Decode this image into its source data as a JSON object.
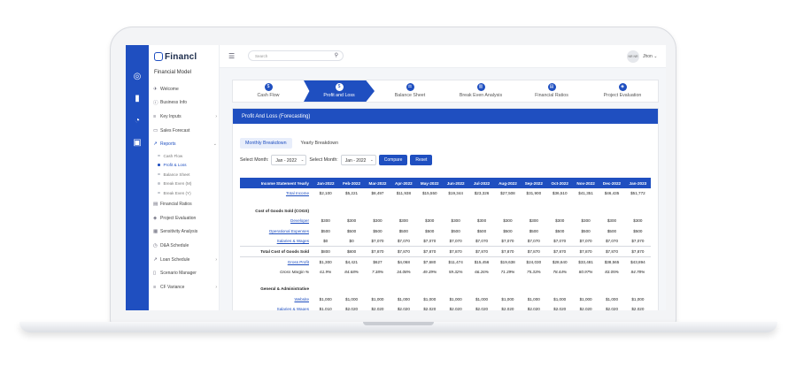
{
  "brand": {
    "name": "Financl",
    "accent": "#1f4fc0"
  },
  "sidebar": {
    "title": "Financial Model",
    "items": [
      {
        "label": "Welcome",
        "icon": "rocket-icon",
        "chevron": false
      },
      {
        "label": "Business Info",
        "icon": "info-icon",
        "chevron": false
      },
      {
        "label": "Key Inputs",
        "icon": "list-icon",
        "chevron": true
      },
      {
        "label": "Sales Forecast",
        "icon": "sales-icon",
        "chevron": false
      },
      {
        "label": "Reports",
        "icon": "trend-icon",
        "chevron": true,
        "active": true
      }
    ],
    "report_subitems": [
      {
        "label": "Cash Flow"
      },
      {
        "label": "Profit & Loss",
        "active": true
      },
      {
        "label": "Balance Sheet"
      },
      {
        "label": "Break Even (M)"
      },
      {
        "label": "Break Even (Y)"
      }
    ],
    "items_after": [
      {
        "label": "Financial Ratios",
        "icon": "ratio-icon",
        "chevron": false
      },
      {
        "label": "Project Evaluation",
        "icon": "evaluation-icon",
        "chevron": false
      },
      {
        "label": "Sensitivity Analysis",
        "icon": "grid-icon",
        "chevron": false
      },
      {
        "label": "D&A Schedule",
        "icon": "clock-icon",
        "chevron": false
      },
      {
        "label": "Loan Schedule",
        "icon": "trend-icon",
        "chevron": true
      },
      {
        "label": "Scenario Manager",
        "icon": "doc-icon",
        "chevron": false
      },
      {
        "label": "CF Variance",
        "icon": "list-icon",
        "chevron": true
      }
    ]
  },
  "header": {
    "search_placeholder": "Search",
    "avatar_initials": "NR NR",
    "user_name": "Jhon"
  },
  "steps": [
    {
      "label": "Cash Flow",
      "icon": "currency-icon"
    },
    {
      "label": "Profit and Loss",
      "icon": "currency-icon",
      "active": true
    },
    {
      "label": "Balance Sheet",
      "icon": "balance-icon"
    },
    {
      "label": "Break Even Analysis",
      "icon": "chart-icon"
    },
    {
      "label": "Financial Ratios",
      "icon": "ratio-icon"
    },
    {
      "label": "Project Evaluation",
      "icon": "evaluation-icon"
    }
  ],
  "panel": {
    "title": "Profit And Loss (Forecasting)",
    "tabs": [
      {
        "label": "Monthly Breakdown",
        "active": true
      },
      {
        "label": "Yearly Breakdown"
      }
    ],
    "filters": {
      "label1": "Select Month:",
      "value1": "Jan - 2022",
      "label2": "Select Month:",
      "value2": "Jan - 2022",
      "compare": "Compare",
      "reset": "Reset"
    }
  },
  "table": {
    "header_label": "Income Statement Yearly",
    "columns": [
      "Jan-2022",
      "Feb-2022",
      "Mar-2022",
      "Apr-2022",
      "May-2022",
      "Jun-2022",
      "Jul-2022",
      "Aug-2022",
      "Sep-2022",
      "Oct-2022",
      "Nov-2022",
      "Dec-2022",
      "Jan-2023"
    ],
    "rows": [
      {
        "label": "Total Income",
        "style": "link",
        "values": [
          "$2,100",
          "$5,221",
          "$8,497",
          "$11,938",
          "$15,550",
          "$19,344",
          "$23,326",
          "$27,508",
          "$31,900",
          "$36,510",
          "$41,351",
          "$46,435",
          "$51,772"
        ]
      },
      {
        "label": "",
        "style": "spacer",
        "values": []
      },
      {
        "label": "Cost of Goods Sold (COGS)",
        "style": "section",
        "values": []
      },
      {
        "label": "Developer",
        "style": "link",
        "values": [
          "$300",
          "$300",
          "$300",
          "$300",
          "$300",
          "$300",
          "$300",
          "$300",
          "$300",
          "$300",
          "$300",
          "$300",
          "$300"
        ]
      },
      {
        "label": "Operational Expenses",
        "style": "link",
        "values": [
          "$500",
          "$500",
          "$500",
          "$500",
          "$500",
          "$500",
          "$500",
          "$500",
          "$500",
          "$500",
          "$500",
          "$500",
          "$500"
        ]
      },
      {
        "label": "Salaries & Wages",
        "style": "link",
        "values": [
          "$0",
          "$0",
          "$7,070",
          "$7,070",
          "$7,070",
          "$7,070",
          "$7,070",
          "$7,070",
          "$7,070",
          "$7,070",
          "$7,070",
          "$7,070",
          "$7,070"
        ]
      },
      {
        "label": "Total Cost of Goods Sold",
        "style": "boxed",
        "values": [
          "$800",
          "$800",
          "$7,870",
          "$7,870",
          "$7,870",
          "$7,870",
          "$7,870",
          "$7,870",
          "$7,870",
          "$7,870",
          "$7,870",
          "$7,870",
          "$7,870"
        ]
      },
      {
        "label": "Gross Profit",
        "style": "link",
        "values": [
          "$1,300",
          "$4,421",
          "$627",
          "$4,068",
          "$7,680",
          "$11,474",
          "$15,456",
          "$19,638",
          "$24,030",
          "$28,640",
          "$33,481",
          "$38,565",
          "$43,894"
        ]
      },
      {
        "label": "Gross Margin %",
        "style": "italic",
        "values": [
          "61.9%",
          "84.68%",
          "7.38%",
          "34.08%",
          "49.39%",
          "59.32%",
          "66.26%",
          "71.39%",
          "75.33%",
          "78.44%",
          "80.97%",
          "83.05%",
          "84.78%"
        ]
      },
      {
        "label": "",
        "style": "spacer",
        "values": []
      },
      {
        "label": "General & Administrative",
        "style": "section",
        "values": []
      },
      {
        "label": "Website",
        "style": "link",
        "values": [
          "$1,000",
          "$1,000",
          "$1,000",
          "$1,000",
          "$1,000",
          "$1,000",
          "$1,000",
          "$1,000",
          "$1,000",
          "$1,000",
          "$1,000",
          "$1,000",
          "$1,000"
        ]
      },
      {
        "label": "Salaries & Wages",
        "style": "link",
        "values": [
          "$1,010",
          "$2,020",
          "$2,020",
          "$2,020",
          "$2,020",
          "$2,020",
          "$2,020",
          "$2,020",
          "$2,020",
          "$2,020",
          "$2,020",
          "$2,020",
          "$2,020"
        ]
      }
    ]
  }
}
